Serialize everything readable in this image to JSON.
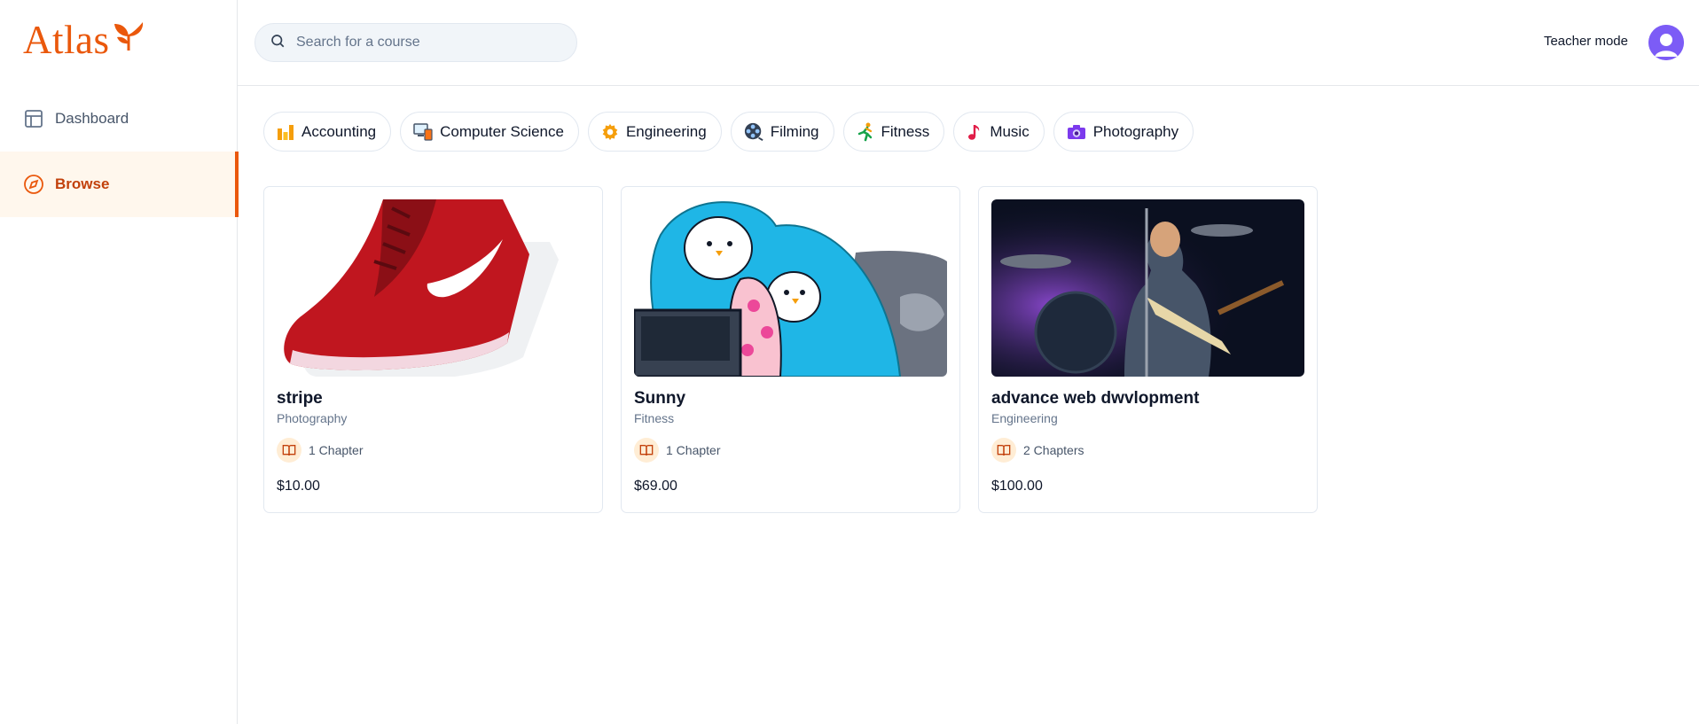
{
  "brand": {
    "name": "Atlas",
    "color": "#ea580c"
  },
  "sidebar": {
    "items": [
      {
        "label": "Dashboard",
        "icon": "layout-icon",
        "active": false
      },
      {
        "label": "Browse",
        "icon": "compass-icon",
        "active": true
      }
    ]
  },
  "header": {
    "search_placeholder": "Search for a course",
    "search_value": "",
    "teacher_mode_label": "Teacher mode",
    "avatar_icon": "user-avatar-icon"
  },
  "categories": [
    {
      "label": "Accounting",
      "icon": "bar-chart-icon"
    },
    {
      "label": "Computer Science",
      "icon": "devices-icon"
    },
    {
      "label": "Engineering",
      "icon": "gear-icon"
    },
    {
      "label": "Filming",
      "icon": "film-reel-icon"
    },
    {
      "label": "Fitness",
      "icon": "runner-icon"
    },
    {
      "label": "Music",
      "icon": "music-note-icon"
    },
    {
      "label": "Photography",
      "icon": "camera-icon"
    }
  ],
  "courses": [
    {
      "title": "stripe",
      "category": "Photography",
      "chapters": "1 Chapter",
      "price": "$10.00",
      "image": "red-sneaker-image"
    },
    {
      "title": "Sunny",
      "category": "Fitness",
      "chapters": "1 Chapter",
      "price": "$69.00",
      "image": "penguins-blanket-image"
    },
    {
      "title": "advance web dwvlopment",
      "category": "Engineering",
      "chapters": "2 Chapters",
      "price": "$100.00",
      "image": "concert-guitarist-image"
    }
  ]
}
